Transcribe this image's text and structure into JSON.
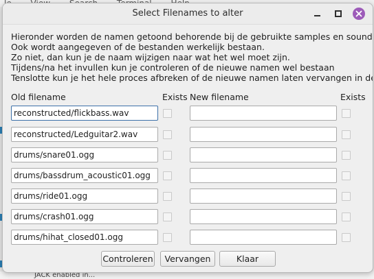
{
  "background": {
    "menu": [
      "le",
      "View",
      "Search",
      "Terminal",
      "Help"
    ],
    "status": "JACK enabled in..."
  },
  "window": {
    "title": "Select Filenames to alter",
    "accent_color": "#9d5bb9"
  },
  "info_lines": [
    "Hieronder worden de namen getoond behorende bij de gebruikte samples en soundfonts.",
    "Ook wordt aangegeven of de bestanden werkelijk bestaan.",
    "Zo niet, dan kun je de naam wijzigen naar wat het wel moet zijn.",
    "Tijdens/na het invullen kun je controleren of de nieuwe namen wel bestaan",
    "Tenslotte kun je het hele proces afbreken of de nieuwe namen laten vervangen in de xml"
  ],
  "headers": {
    "old": "Old filename",
    "exists": "Exists",
    "new": "New filename",
    "exists2": "Exists"
  },
  "rows": [
    {
      "old": "reconstructed/flickbass.wav",
      "new": "",
      "exists_old": false,
      "exists_new": false
    },
    {
      "old": "reconstructed/Ledguitar2.wav",
      "new": "",
      "exists_old": false,
      "exists_new": false
    },
    {
      "old": "drums/snare01.ogg",
      "new": "",
      "exists_old": false,
      "exists_new": false
    },
    {
      "old": "drums/bassdrum_acoustic01.ogg",
      "new": "",
      "exists_old": false,
      "exists_new": false
    },
    {
      "old": "drums/ride01.ogg",
      "new": "",
      "exists_old": false,
      "exists_new": false
    },
    {
      "old": "drums/crash01.ogg",
      "new": "",
      "exists_old": false,
      "exists_new": false
    },
    {
      "old": "drums/hihat_closed01.ogg",
      "new": "",
      "exists_old": false,
      "exists_new": false
    }
  ],
  "buttons": {
    "controleren": "Controleren",
    "vervangen": "Vervangen",
    "klaar": "Klaar"
  }
}
